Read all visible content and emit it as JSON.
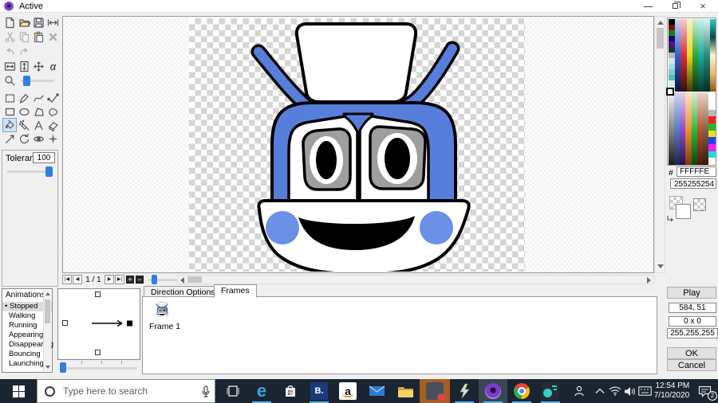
{
  "window": {
    "title": "Active"
  },
  "titlebar": {
    "close_glyph": "×"
  },
  "toolbar": {
    "tolerance_label": "Tolerance",
    "tolerance_value": "100",
    "alpha_glyph": "α"
  },
  "frame_nav": {
    "counter": "1 / 1",
    "add_glyph": "+",
    "remove_glyph": "−"
  },
  "color_panel": {
    "hash_label": "#",
    "hex_value": "FFFFFE",
    "rgb": [
      "255",
      "255",
      "254"
    ]
  },
  "palette": {
    "selected_color": "#ffffff",
    "accent_column": [
      "#000000",
      "#7a1010",
      "#1a7a1a",
      "#0e0e66",
      "#581080",
      "#0f3a3a",
      "#b8b8b8",
      "#d2e6e6",
      "#a8dcdc",
      "#7ccccc",
      "#54bcbc",
      "#d8eeee",
      "#eaf6f6"
    ],
    "top_columns": [
      [
        "#ccd8f2",
        "#3a5cd0",
        "#0c1236"
      ],
      [
        "#f2ccd2",
        "#d63040",
        "#360c10"
      ],
      [
        "#f6f2c8",
        "#e8d822",
        "#44360a"
      ],
      [
        "#d2eed2",
        "#34a438",
        "#0a360c"
      ],
      [
        "#c8f0ec",
        "#1aaea0",
        "#0a3632"
      ],
      [
        "#def2ee",
        "#2a8a7a",
        "#062a24"
      ],
      [
        "#28cfc9",
        "#0a4a44",
        "#fdf4da",
        "#f0b868",
        "#8a5a1a"
      ]
    ],
    "bottom_columns": [
      [
        "#f2f2f2",
        "#8a8a8a",
        "#1a1a1a"
      ],
      [
        "#ccd8f0",
        "#5c7cc4",
        "#182848"
      ],
      [
        "#e2d0f0",
        "#8c50cc",
        "#28104c"
      ],
      [
        "#fce2c4",
        "#ee9434",
        "#783c0a"
      ],
      [
        "#d6f0ce",
        "#2cbe3e",
        "#0a480e"
      ],
      [
        "#f0d2ca",
        "#bc5434",
        "#4c180a"
      ],
      [
        "#e6d8ca",
        "#8c6244",
        "#2e1a0a"
      ]
    ],
    "right_accents": [
      "#ffffff",
      "#b8b8b8",
      "#ee2222",
      "#22bb22",
      "#eedd22",
      "#2244ee",
      "#ee22ee",
      "#22dddd",
      "#ffffff"
    ]
  },
  "animations": {
    "header": "Animations",
    "bullet": "•",
    "selected_index": 0,
    "items": [
      "Stopped",
      "Walking",
      "Running",
      "Appearing",
      "Disappearing",
      "Bouncing",
      "Launching"
    ]
  },
  "tabs": {
    "direction_options": "Direction Options",
    "frames": "Frames"
  },
  "frames_tab": {
    "frame_label": "Frame 1"
  },
  "side_panel": {
    "play": "Play",
    "position": "584, 51",
    "size": "0 x 0",
    "rgb": "255,255,255",
    "ok": "OK",
    "cancel": "Cancel"
  },
  "taskbar": {
    "search_placeholder": "Type here to search",
    "b_tile": "B.",
    "amazon_letter": "a",
    "edge_letter": "e",
    "clock_time": "12:54 PM",
    "clock_date": "7/10/2020",
    "notification_count": "2"
  }
}
